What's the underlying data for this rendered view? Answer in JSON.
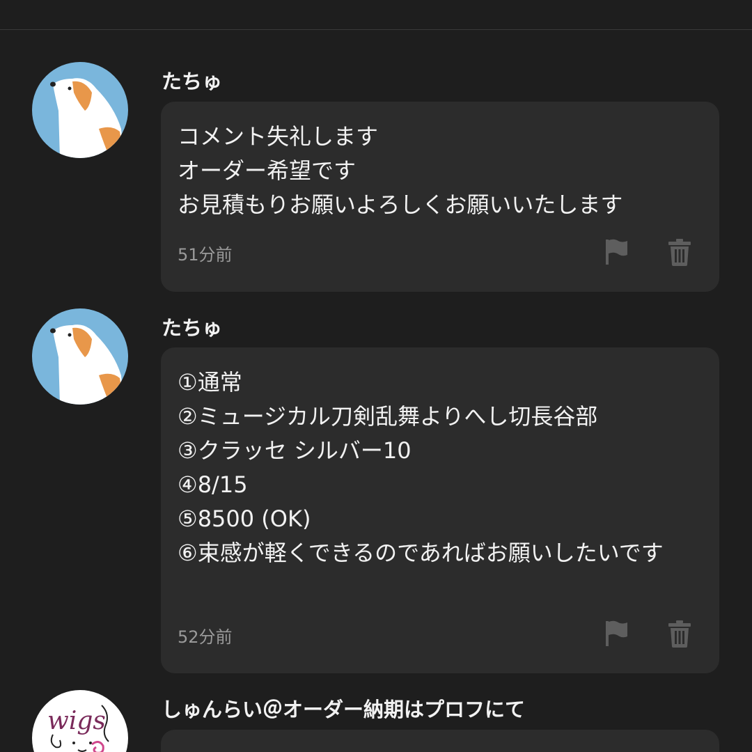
{
  "comments": [
    {
      "username": "たちゅ",
      "body": "コメント失礼します\nオーダー希望です\nお見積もりお願いよろしくお願いいたします",
      "time": "51分前",
      "avatar_icon": "dog-avatar-icon"
    },
    {
      "username": "たちゅ",
      "body": "①通常\n②ミュージカル刀剣乱舞よりへし切長谷部\n③クラッセ シルバー10\n④8/15\n⑤8500 (OK)\n⑥束感が軽くできるのであればお願いしたいです",
      "time": "52分前",
      "avatar_icon": "dog-avatar-icon"
    },
    {
      "username": "しゅんらい＠オーダー納期はプロフにて",
      "avatar_icon": "wigs-logo-avatar-icon",
      "avatar_logo_text": "wigs"
    }
  ],
  "icons": {
    "report": "flag-icon",
    "delete": "trash-icon"
  },
  "colors": {
    "background": "#1e1e1e",
    "bubble": "#2c2c2c",
    "muted": "#9a9a9a",
    "icon": "#5e5e5e",
    "avatar_blue": "#7ab6dc"
  }
}
